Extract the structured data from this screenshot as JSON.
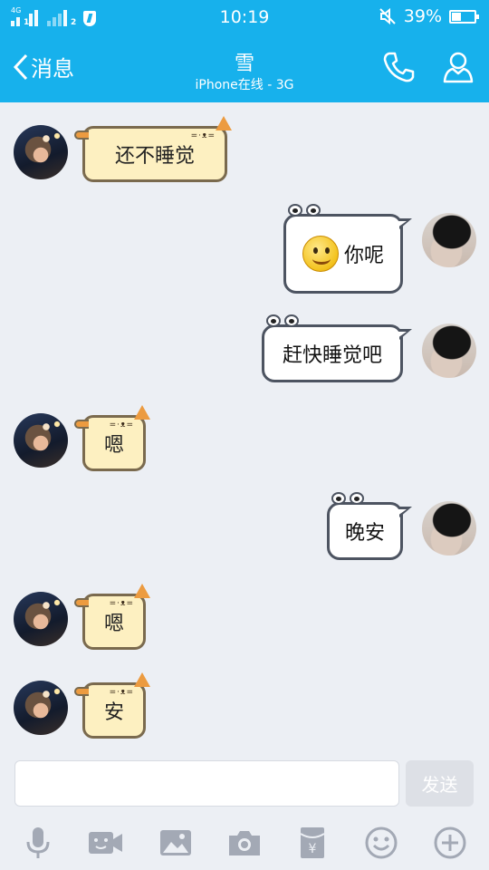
{
  "status_bar": {
    "network_label": "4G",
    "sim1": "1",
    "sim2": "2",
    "time": "10:19",
    "battery": "39%",
    "battery_level": 0.39
  },
  "header": {
    "back_label": "消息",
    "contact_name": "雪",
    "contact_status": "iPhone在线 - 3G",
    "accent_color": "#17b1ec"
  },
  "messages": [
    {
      "from": "peer",
      "text": "还不睡觉"
    },
    {
      "from": "me",
      "text": "你呢",
      "emoji": "smiley-emoji"
    },
    {
      "from": "me",
      "text": "赶快睡觉吧"
    },
    {
      "from": "peer",
      "text": "嗯"
    },
    {
      "from": "me",
      "text": "晚安"
    },
    {
      "from": "peer",
      "text": "嗯"
    },
    {
      "from": "peer",
      "text": "安"
    }
  ],
  "composer": {
    "input_value": "",
    "send_label": "发送"
  },
  "toolbar": [
    "mic-icon",
    "video-icon",
    "image-icon",
    "camera-icon",
    "red-packet-icon",
    "emoji-icon",
    "plus-icon"
  ]
}
